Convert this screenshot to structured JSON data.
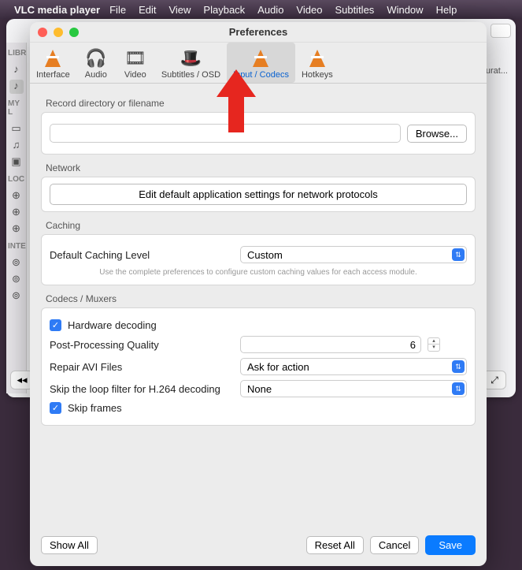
{
  "menubar": {
    "app": "VLC media player",
    "items": [
      "File",
      "Edit",
      "View",
      "Playback",
      "Audio",
      "Video",
      "Subtitles",
      "Window",
      "Help"
    ]
  },
  "background": {
    "sections": [
      "LIBR",
      "MY L",
      "LOC",
      "INTE"
    ],
    "column": "Durat...",
    "prev": "◂◂",
    "full": "⤢"
  },
  "prefs": {
    "title": "Preferences",
    "tabs": [
      {
        "label": "Interface"
      },
      {
        "label": "Audio"
      },
      {
        "label": "Video"
      },
      {
        "label": "Subtitles / OSD"
      },
      {
        "label": "Input / Codecs"
      },
      {
        "label": "Hotkeys"
      }
    ],
    "record": {
      "label": "Record directory or filename",
      "value": "",
      "browse": "Browse..."
    },
    "network": {
      "label": "Network",
      "button": "Edit default application settings for network protocols"
    },
    "caching": {
      "label": "Caching",
      "level_label": "Default Caching Level",
      "level_value": "Custom",
      "hint": "Use the complete preferences to configure custom caching values for each access module."
    },
    "codecs": {
      "label": "Codecs / Muxers",
      "hardware": "Hardware decoding",
      "post_label": "Post-Processing Quality",
      "post_value": "6",
      "repair_label": "Repair AVI Files",
      "repair_value": "Ask for action",
      "loop_label": "Skip the loop filter for H.264 decoding",
      "loop_value": "None",
      "skip": "Skip frames"
    },
    "footer": {
      "showall": "Show All",
      "reset": "Reset All",
      "cancel": "Cancel",
      "save": "Save"
    }
  }
}
